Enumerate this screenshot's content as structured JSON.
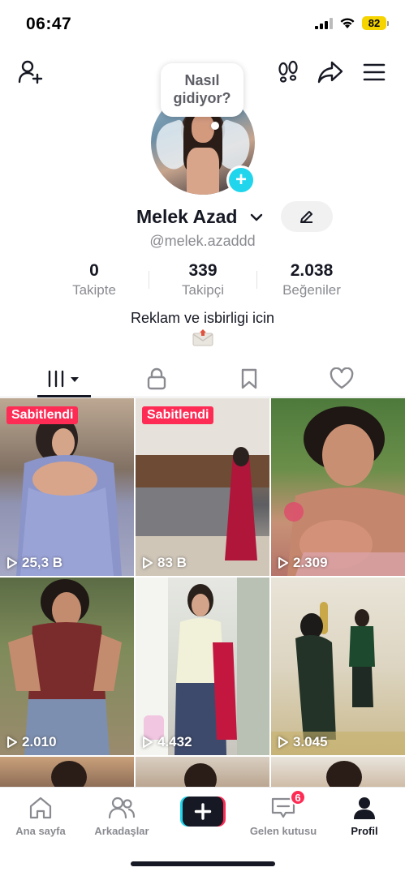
{
  "status_bar": {
    "time": "06:47",
    "battery": "82"
  },
  "avatar_bubble": {
    "line1": "Nasıl",
    "line2": "gidiyor?"
  },
  "profile": {
    "name": "Melek Azad",
    "username": "@melek.azaddd",
    "bio": "Reklam ve isbirligi icin",
    "bio_icon": "envelope-icon"
  },
  "stats": [
    {
      "value": "0",
      "label": "Takipte"
    },
    {
      "value": "339",
      "label": "Takipçi"
    },
    {
      "value": "2.038",
      "label": "Beğeniler"
    }
  ],
  "tabs": [
    "videos-grid-icon",
    "lock-icon",
    "bookmark-icon",
    "heart-icon"
  ],
  "videos": [
    {
      "views": "25,3 B",
      "pinned": "Sabitlendi"
    },
    {
      "views": "83 B",
      "pinned": "Sabitlendi"
    },
    {
      "views": "2.309",
      "pinned": ""
    },
    {
      "views": "2.010",
      "pinned": ""
    },
    {
      "views": "4.432",
      "pinned": ""
    },
    {
      "views": "3.045",
      "pinned": ""
    }
  ],
  "bottom_nav": {
    "home": "Ana sayfa",
    "friends": "Arkadaşlar",
    "inbox": "Gelen kutusu",
    "inbox_badge": "6",
    "profile": "Profil"
  },
  "colors": {
    "accent": "#fe2c55",
    "cyan": "#20d5ec",
    "text": "#161823",
    "muted": "#8a8b91"
  }
}
